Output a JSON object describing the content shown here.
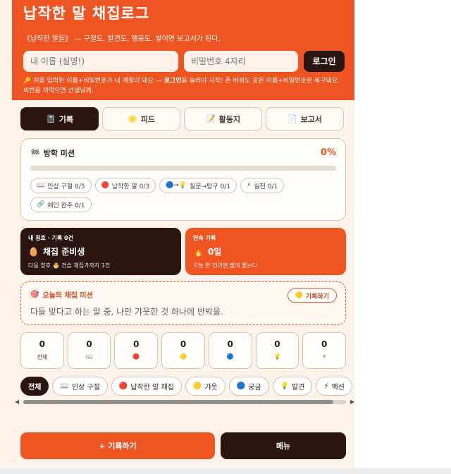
{
  "header": {
    "title": "납작한 말 채집로그",
    "subtitle": "《납작한 말들》 — 구절도, 발견도, 행동도. 쌓이면 보고서가 된다.",
    "name_placeholder": "내 이름 (실명!)",
    "password_placeholder": "비밀번호 4자리",
    "login_label": "로그인",
    "hint_icon": "key-icon",
    "hint_prefix": "처음 입력한 이름+비밀번호가 내 계정이 돼요 — ",
    "hint_bold": "로그인",
    "hint_suffix": "을 눌러야 시작! 폰 바꿔도 같은 이름+비밀번호로 복구돼요. 비번을 까먹으면 선생님께."
  },
  "tabs": [
    {
      "icon": "📓",
      "label": "기록",
      "active": true
    },
    {
      "icon": "🌟",
      "label": "피드",
      "active": false
    },
    {
      "icon": "📝",
      "label": "활동지",
      "active": false
    },
    {
      "icon": "📄",
      "label": "보고서",
      "active": false
    }
  ],
  "mission": {
    "icon": "🏁",
    "title": "방학 미션",
    "percent": "0%",
    "progress": 0,
    "chips": [
      {
        "icon": "📖",
        "label": "인상 구절 0/5"
      },
      {
        "icon": "🔴",
        "label": "납작한 말 0/3"
      },
      {
        "icon": "🔵→💡",
        "label": "질문→탐구 0/1"
      },
      {
        "icon": "⚡",
        "label": "실천 0/1"
      },
      {
        "icon": "🔗",
        "label": "체인 완주 0/1"
      }
    ]
  },
  "rank": {
    "label": "내 칭호 · 기록 0건",
    "icon": "🥚",
    "value": "채집 준비생",
    "next": "다음 칭호 🐣 견습 채집가까지 1건"
  },
  "streak": {
    "label": "연속 기록",
    "icon": "🔥",
    "value": "0일",
    "note": "오늘 한 건이면 불이 붙는다"
  },
  "today": {
    "icon": "🎯",
    "title": "오늘의 채집 미션",
    "question": "다들 맞다고 하는 말 중, 나만 갸웃한 것 하나에 반박을.",
    "record_icon": "🟡",
    "record_label": "기록하기"
  },
  "counts": [
    {
      "n": "0",
      "label": "전체"
    },
    {
      "n": "0",
      "label": "📖"
    },
    {
      "n": "0",
      "label": "🔴"
    },
    {
      "n": "0",
      "label": "🟡"
    },
    {
      "n": "0",
      "label": "🔵"
    },
    {
      "n": "0",
      "label": "💡"
    },
    {
      "n": "0",
      "label": "⚡"
    }
  ],
  "filters": [
    {
      "icon": "",
      "label": "전체",
      "active": true
    },
    {
      "icon": "📖",
      "label": "인상 구절",
      "active": false
    },
    {
      "icon": "🔴",
      "label": "납작한 말 채집",
      "active": false
    },
    {
      "icon": "🟡",
      "label": "갸웃",
      "active": false
    },
    {
      "icon": "🔵",
      "label": "궁금",
      "active": false
    },
    {
      "icon": "💡",
      "label": "발견",
      "active": false
    },
    {
      "icon": "⚡",
      "label": "액션",
      "active": false
    }
  ],
  "bottom": {
    "add_label": "+ 기록하기",
    "menu_label": "메뉴"
  },
  "colors": {
    "accent": "#ef5523",
    "dark": "#2a1510",
    "background": "#fdf3ea"
  }
}
